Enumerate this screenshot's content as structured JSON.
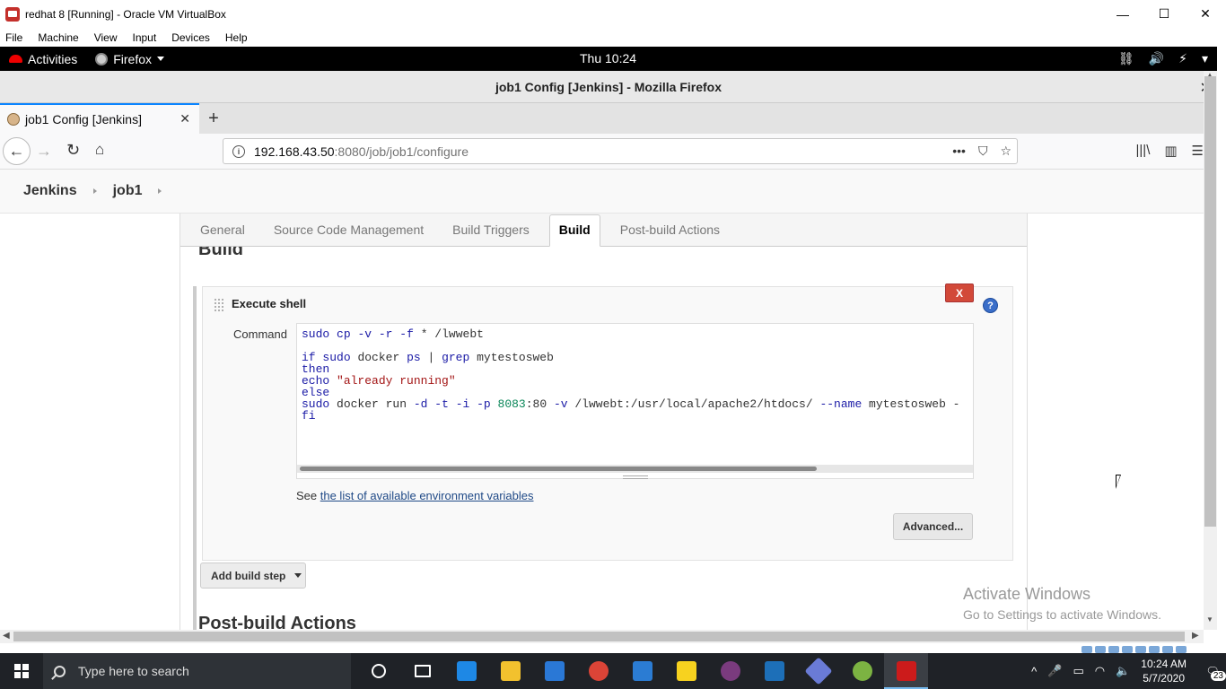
{
  "vbox": {
    "title": "redhat 8 [Running] - Oracle VM VirtualBox",
    "controls": {
      "minimize": "—",
      "maximize": "☐",
      "close": "✕"
    },
    "menu": [
      "File",
      "Machine",
      "View",
      "Input",
      "Devices",
      "Help"
    ]
  },
  "gnome": {
    "activities": "Activities",
    "app": "Firefox",
    "clock": "Thu 10:24",
    "tray": {
      "network": "⛓",
      "volume": "🔊",
      "power": "⚡",
      "menu": "▾"
    }
  },
  "firefox": {
    "window_title": "job1 Config [Jenkins] - Mozilla Firefox",
    "close": "✕",
    "tab_label": "job1 Config [Jenkins]",
    "tab_close": "✕",
    "new_tab": "+",
    "nav": {
      "back": "←",
      "forward": "→",
      "reload": "↻",
      "home": "⌂"
    },
    "url_host": "192.168.43.50",
    "url_rest": ":8080/job/job1/configure",
    "url_actions": {
      "more": "•••",
      "pocket": "⛉",
      "bookmark": "☆"
    },
    "toolbar": {
      "library": "|||\\",
      "sidebar": "▥",
      "menu": "☰"
    }
  },
  "jenkins": {
    "breadcrumbs": [
      "Jenkins",
      "job1"
    ],
    "tabs": [
      "General",
      "Source Code Management",
      "Build Triggers",
      "Build",
      "Post-build Actions"
    ],
    "active_tab": "Build",
    "section_title": "Build",
    "step": {
      "title": "Execute shell",
      "delete_label": "X",
      "help_label": "?",
      "command_label": "Command",
      "code_lines": [
        "sudo cp -v -r -f * /lwwebt",
        "",
        "if sudo docker ps | grep mytestosweb",
        "then",
        "echo \"already running\"",
        "else",
        "sudo docker run -d -t -i -p 8083:80 -v /lwwebt:/usr/local/apache2/htdocs/ --name mytestosweb -",
        "fi"
      ],
      "env_prefix": "See ",
      "env_link": "the list of available environment variables",
      "advanced_label": "Advanced..."
    },
    "add_step_label": "Add build step",
    "post_section_title": "Post-build Actions"
  },
  "watermark": {
    "line1": "Activate Windows",
    "line2": "Go to Settings to activate Windows."
  },
  "scroll": {
    "up": "▲",
    "down": "▼",
    "left": "◀",
    "right": "▶"
  },
  "taskbar": {
    "search_placeholder": "Type here to search",
    "tray_glyphs": {
      "chevron": "^",
      "mic": "🎤",
      "battery": "▭",
      "wifi": "◠",
      "volume": "🔈"
    },
    "time": "10:24 AM",
    "date": "5/7/2020",
    "notification_count": "23",
    "notification_glyph": "🗨",
    "icon_colors": {
      "edge": "#1e88e5",
      "explorer": "#f2c12e",
      "store": "#2a78d6",
      "chrome": "#db4437",
      "mail": "#2b7cd3",
      "sticky": "#f7d21f",
      "slack": "#7a3b7e",
      "vbox": "#1d6fb8",
      "git": "#6a7bd6",
      "paint": "#7cb342",
      "redhat": "#cc1b1b"
    }
  }
}
